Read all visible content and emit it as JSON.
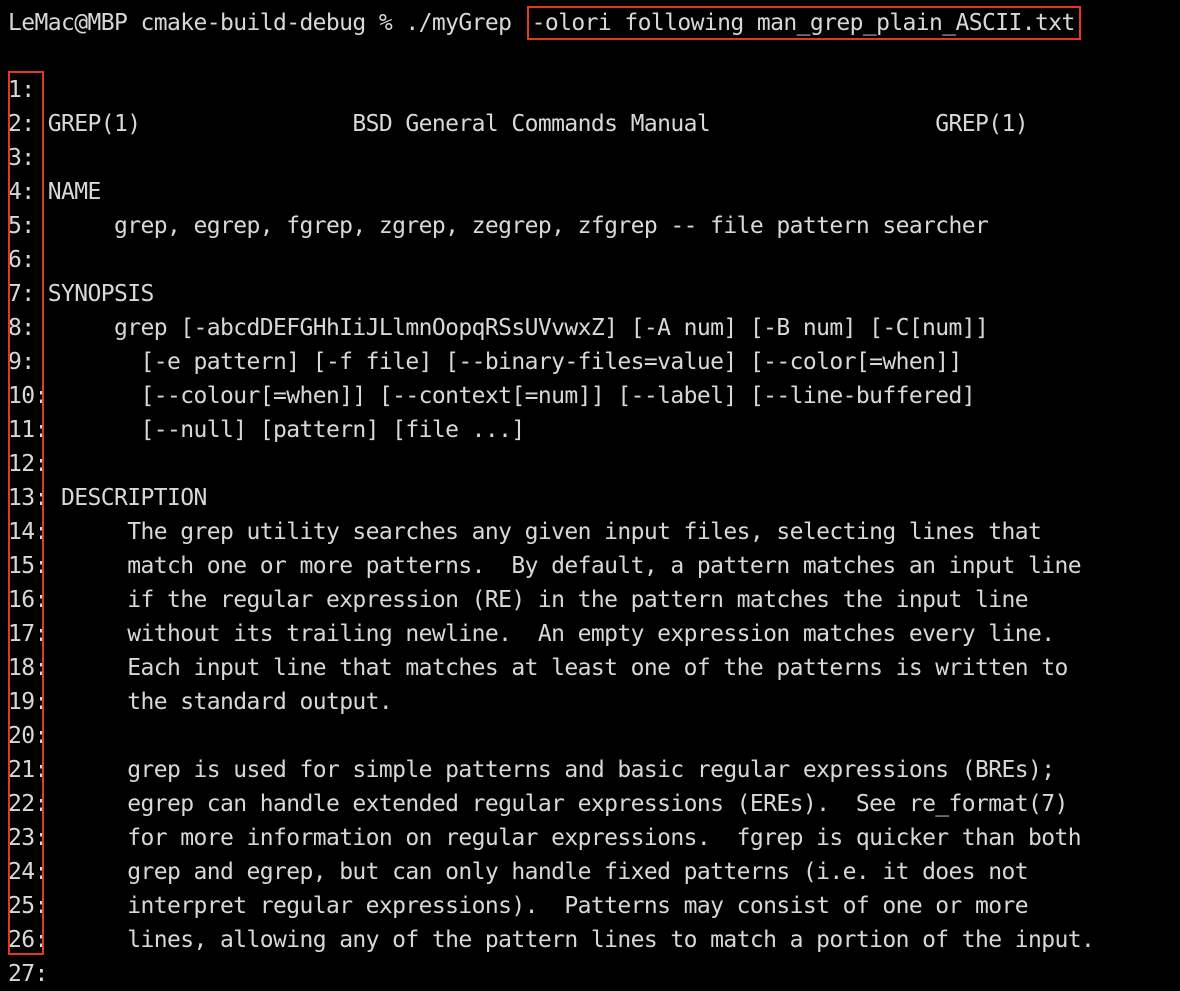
{
  "terminal": {
    "prompt": "LeMac@MBP cmake-build-debug % ./myGrep ",
    "command_args": "-olori following man_grep_plain_ASCII.txt",
    "highlight_color": "#e03a22",
    "text_color": "#d8d8d8",
    "background_color": "#000000"
  },
  "output_lines": [
    {
      "num": "1:",
      "text": ""
    },
    {
      "num": "2:",
      "text": " GREP(1)                BSD General Commands Manual                 GREP(1)"
    },
    {
      "num": "3:",
      "text": ""
    },
    {
      "num": "4:",
      "text": " NAME"
    },
    {
      "num": "5:",
      "text": "      grep, egrep, fgrep, zgrep, zegrep, zfgrep -- file pattern searcher"
    },
    {
      "num": "6:",
      "text": ""
    },
    {
      "num": "7:",
      "text": " SYNOPSIS"
    },
    {
      "num": "8:",
      "text": "      grep [-abcdDEFGHhIiJLlmnOopqRSsUVvwxZ] [-A num] [-B num] [-C[num]]"
    },
    {
      "num": "9:",
      "text": "        [-e pattern] [-f file] [--binary-files=value] [--color[=when]]"
    },
    {
      "num": "10:",
      "text": "       [--colour[=when]] [--context[=num]] [--label] [--line-buffered]"
    },
    {
      "num": "11:",
      "text": "       [--null] [pattern] [file ...]"
    },
    {
      "num": "12:",
      "text": ""
    },
    {
      "num": "13:",
      "text": " DESCRIPTION"
    },
    {
      "num": "14:",
      "text": "      The grep utility searches any given input files, selecting lines that"
    },
    {
      "num": "15:",
      "text": "      match one or more patterns.  By default, a pattern matches an input line"
    },
    {
      "num": "16:",
      "text": "      if the regular expression (RE) in the pattern matches the input line"
    },
    {
      "num": "17:",
      "text": "      without its trailing newline.  An empty expression matches every line."
    },
    {
      "num": "18:",
      "text": "      Each input line that matches at least one of the patterns is written to"
    },
    {
      "num": "19:",
      "text": "      the standard output."
    },
    {
      "num": "20:",
      "text": ""
    },
    {
      "num": "21:",
      "text": "      grep is used for simple patterns and basic regular expressions (BREs);"
    },
    {
      "num": "22:",
      "text": "      egrep can handle extended regular expressions (EREs).  See re_format(7)"
    },
    {
      "num": "23:",
      "text": "      for more information on regular expressions.  fgrep is quicker than both"
    },
    {
      "num": "24:",
      "text": "      grep and egrep, but can only handle fixed patterns (i.e. it does not"
    },
    {
      "num": "25:",
      "text": "      interpret regular expressions).  Patterns may consist of one or more"
    },
    {
      "num": "26:",
      "text": "      lines, allowing any of the pattern lines to match a portion of the input."
    },
    {
      "num": "27:",
      "text": ""
    }
  ]
}
